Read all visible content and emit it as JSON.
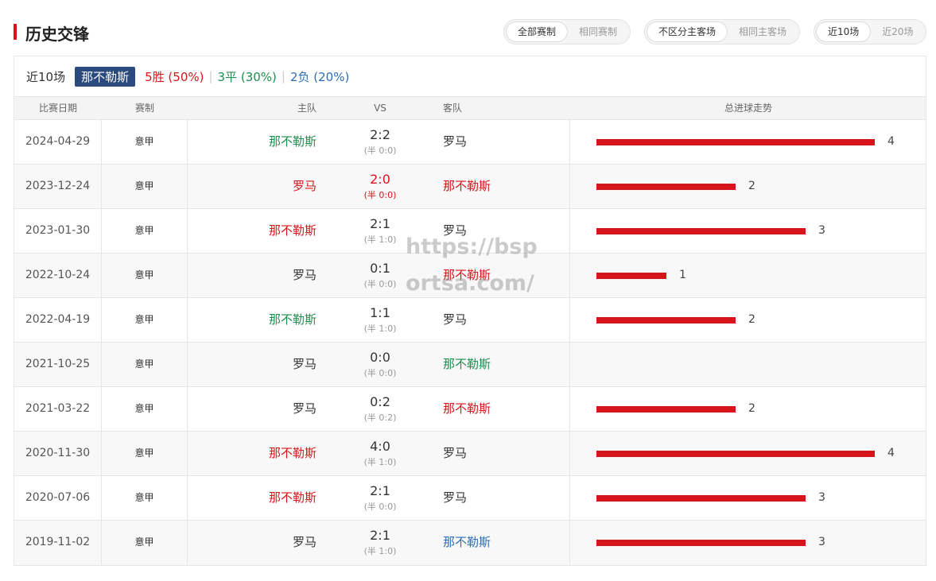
{
  "header": {
    "title": "历史交锋",
    "filters": [
      {
        "options": [
          "全部赛制",
          "相同赛制"
        ],
        "active": 0
      },
      {
        "options": [
          "不区分主客场",
          "相同主客场"
        ],
        "active": 0
      },
      {
        "options": [
          "近10场",
          "近20场"
        ],
        "active": 0
      }
    ]
  },
  "summary": {
    "label": "近10场",
    "team": "那不勒斯",
    "win": "5胜 (50%)",
    "draw": "3平 (30%)",
    "loss": "2负 (20%)",
    "sep": "|"
  },
  "columns": [
    "比赛日期",
    "赛制",
    "主队",
    "VS",
    "客队",
    "总进球走势"
  ],
  "matches": [
    {
      "date": "2024-04-29",
      "comp": "意甲",
      "home": "那不勒斯",
      "home_color": "green",
      "score": "2:2",
      "ht": "(半 0:0)",
      "score_color": "dark",
      "away": "罗马",
      "away_color": "dark",
      "goals": 4
    },
    {
      "date": "2023-12-24",
      "comp": "意甲",
      "home": "罗马",
      "home_color": "red",
      "score": "2:0",
      "ht": "(半 0:0)",
      "score_color": "red",
      "away": "那不勒斯",
      "away_color": "red",
      "goals": 2
    },
    {
      "date": "2023-01-30",
      "comp": "意甲",
      "home": "那不勒斯",
      "home_color": "red",
      "score": "2:1",
      "ht": "(半 1:0)",
      "score_color": "dark",
      "away": "罗马",
      "away_color": "dark",
      "goals": 3
    },
    {
      "date": "2022-10-24",
      "comp": "意甲",
      "home": "罗马",
      "home_color": "dark",
      "score": "0:1",
      "ht": "(半 0:0)",
      "score_color": "dark",
      "away": "那不勒斯",
      "away_color": "red",
      "goals": 1
    },
    {
      "date": "2022-04-19",
      "comp": "意甲",
      "home": "那不勒斯",
      "home_color": "green",
      "score": "1:1",
      "ht": "(半 1:0)",
      "score_color": "dark",
      "away": "罗马",
      "away_color": "dark",
      "goals": 2
    },
    {
      "date": "2021-10-25",
      "comp": "意甲",
      "home": "罗马",
      "home_color": "dark",
      "score": "0:0",
      "ht": "(半 0:0)",
      "score_color": "dark",
      "away": "那不勒斯",
      "away_color": "green",
      "goals": 0
    },
    {
      "date": "2021-03-22",
      "comp": "意甲",
      "home": "罗马",
      "home_color": "dark",
      "score": "0:2",
      "ht": "(半 0:2)",
      "score_color": "dark",
      "away": "那不勒斯",
      "away_color": "red",
      "goals": 2
    },
    {
      "date": "2020-11-30",
      "comp": "意甲",
      "home": "那不勒斯",
      "home_color": "red",
      "score": "4:0",
      "ht": "(半 1:0)",
      "score_color": "dark",
      "away": "罗马",
      "away_color": "dark",
      "goals": 4
    },
    {
      "date": "2020-07-06",
      "comp": "意甲",
      "home": "那不勒斯",
      "home_color": "red",
      "score": "2:1",
      "ht": "(半 0:0)",
      "score_color": "dark",
      "away": "罗马",
      "away_color": "dark",
      "goals": 3
    },
    {
      "date": "2019-11-02",
      "comp": "意甲",
      "home": "罗马",
      "home_color": "dark",
      "score": "2:1",
      "ht": "(半 1:0)",
      "score_color": "dark",
      "away": "那不勒斯",
      "away_color": "blue",
      "goals": 3
    }
  ],
  "trend_max": 4,
  "watermark": "https://bsportsa.com/",
  "colors": {
    "accent": "#d7141a",
    "win": "#d7141a",
    "draw": "#1e8c4e",
    "loss": "#2f6db5",
    "badge": "#2b4a7e"
  }
}
